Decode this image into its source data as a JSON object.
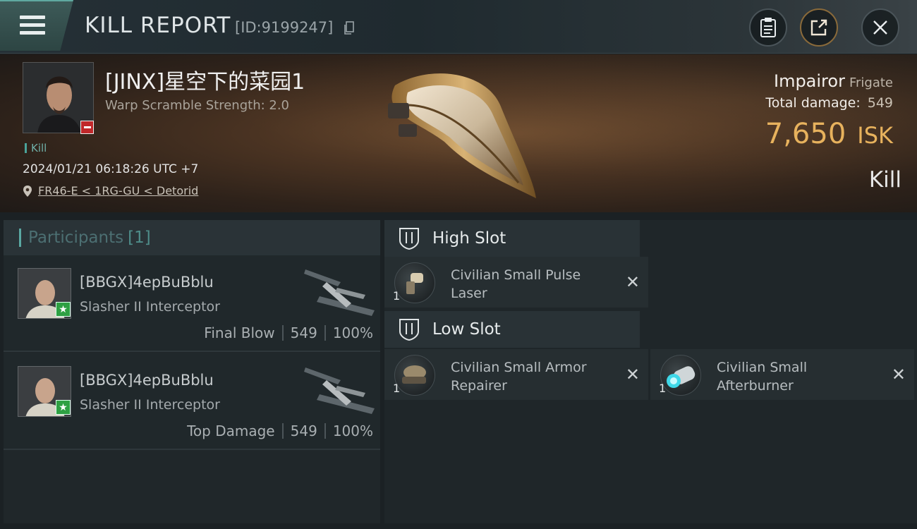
{
  "header": {
    "title": "KILL REPORT",
    "id_label": "[ID:9199247]"
  },
  "victim": {
    "name": "[JINX]星空下的菜园1",
    "warp_scramble": "Warp Scramble Strength: 2.0",
    "kill_tag": "Kill",
    "datetime": "2024/01/21 06:18:26 UTC +7",
    "location": "FR46-E < 1RG-GU < Detorid"
  },
  "ship": {
    "name": "Impairor",
    "class": "Frigate",
    "total_damage_label": "Total damage:",
    "total_damage": "549",
    "isk_value": "7,650",
    "isk_unit": "ISK",
    "result": "Kill"
  },
  "participants": {
    "title": "Participants",
    "count": "[1]",
    "rows": [
      {
        "name": "[BBGX]4epBuBblu",
        "ship": "Slasher II Interceptor",
        "tag": "Final Blow",
        "damage": "549",
        "percent": "100%"
      },
      {
        "name": "[BBGX]4epBuBblu",
        "ship": "Slasher II Interceptor",
        "tag": "Top Damage",
        "damage": "549",
        "percent": "100%"
      }
    ]
  },
  "fitting": {
    "high_slot": {
      "title": "High Slot",
      "modules": [
        {
          "name": "Civilian Small Pulse Laser",
          "qty": "1"
        }
      ]
    },
    "low_slot": {
      "title": "Low Slot",
      "modules": [
        {
          "name": "Civilian Small Armor Repairer",
          "qty": "1"
        },
        {
          "name": "Civilian Small Afterburner",
          "qty": "1"
        }
      ]
    }
  },
  "icons": {
    "menu": "menu-icon",
    "copy": "copy-icon",
    "clipboard": "clipboard-icon",
    "share": "share-icon",
    "close": "close-icon",
    "location": "location-pin-icon",
    "slot": "slot-icon",
    "remove": "x-icon"
  },
  "colors": {
    "isk": "#e6b15c",
    "accent": "#5aa8a2",
    "negative_badge": "#c0282a",
    "positive_badge": "#2ea043"
  }
}
